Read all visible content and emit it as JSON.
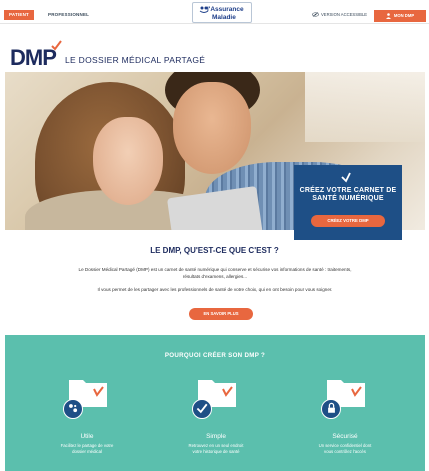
{
  "topbar": {
    "tab_patient": "PATIENT",
    "tab_professional": "PROFESSIONNEL",
    "logo_line1": "l'Assurance",
    "logo_line2": "Maladie",
    "accessible": "VERSION ACCESSIBLE",
    "mon_dmp": "MON DMP"
  },
  "brand": {
    "acronym": "DMP",
    "subtitle": "LE DOSSIER MÉDICAL PARTAGÉ"
  },
  "hero_card": {
    "title_line1": "CRÉEZ VOTRE CARNET DE",
    "title_line2": "SANTÉ NUMÉRIQUE",
    "button": "CRÉEZ VOTRE DMP"
  },
  "what": {
    "title": "LE DMP, QU'EST-CE QUE C'EST ?",
    "paragraph1": "Le Dossier Médical Partagé (DMP) est un carnet de santé numérique qui conserve et sécurise vos informations de santé : traitements, résultats d'examens, allergies...",
    "paragraph2": "Il vous permet de les partager avec les professionnels de santé de votre choix, qui en ont besoin pour vous soigner.",
    "button": "EN SAVOIR PLUS"
  },
  "why": {
    "title": "POURQUOI CRÉER SON DMP ?",
    "features": [
      {
        "name": "Utile",
        "desc_line1": "Facilitez le partage de votre",
        "desc_line2": "dossier médical"
      },
      {
        "name": "Simple",
        "desc_line1": "Retrouvez en un seul endroit",
        "desc_line2": "votre historique de santé"
      },
      {
        "name": "Sécurisé",
        "desc_line1": "Un service confidentiel dont",
        "desc_line2": "vous contrôlez l'accès"
      }
    ]
  },
  "colors": {
    "accent_orange": "#e8673f",
    "navy": "#1d2b5e",
    "card_blue": "#1e4f86",
    "teal": "#5bbfad"
  }
}
